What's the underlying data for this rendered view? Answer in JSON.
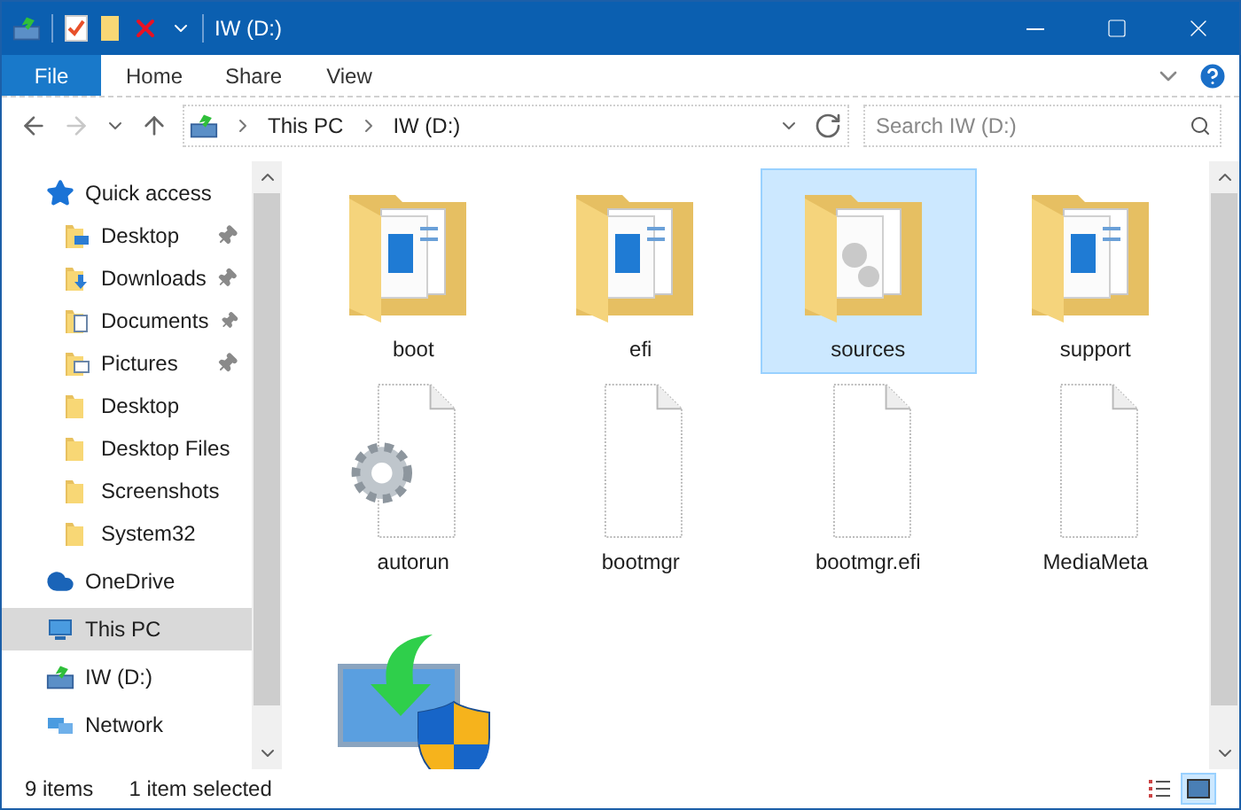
{
  "window": {
    "title": "IW (D:)"
  },
  "ribbon": {
    "tabs": [
      {
        "label": "File",
        "kind": "file",
        "selected": false
      },
      {
        "label": "Home",
        "kind": "tab",
        "selected": false
      },
      {
        "label": "Share",
        "kind": "tab",
        "selected": false
      },
      {
        "label": "View",
        "kind": "tab",
        "selected": false
      }
    ]
  },
  "address": {
    "back_disabled": false,
    "forward_disabled": true,
    "breadcrumb": [
      "This PC",
      "IW (D:)"
    ],
    "search": {
      "placeholder": "Search IW (D:)"
    }
  },
  "sidebar": {
    "items": [
      {
        "label": "Quick access",
        "kind": "star",
        "selected": false,
        "children": [
          {
            "label": "Desktop",
            "kind": "desktop",
            "pinned": true,
            "selected": false
          },
          {
            "label": "Downloads",
            "kind": "downloads",
            "pinned": true,
            "selected": false
          },
          {
            "label": "Documents",
            "kind": "documents",
            "pinned": true,
            "selected": false
          },
          {
            "label": "Pictures",
            "kind": "pictures",
            "pinned": true,
            "selected": false
          },
          {
            "label": "Desktop",
            "kind": "folder",
            "pinned": false,
            "selected": false
          },
          {
            "label": "Desktop Files",
            "kind": "folder",
            "pinned": false,
            "selected": false
          },
          {
            "label": "Screenshots",
            "kind": "folder",
            "pinned": false,
            "selected": false
          },
          {
            "label": "System32",
            "kind": "folder",
            "pinned": false,
            "selected": false
          }
        ]
      },
      {
        "label": "OneDrive",
        "kind": "cloud",
        "selected": false
      },
      {
        "label": "This PC",
        "kind": "pc",
        "selected": true
      },
      {
        "label": "IW (D:)",
        "kind": "drive",
        "selected": false
      },
      {
        "label": "Network",
        "kind": "network",
        "selected": false
      }
    ]
  },
  "files": [
    {
      "name": "boot",
      "kind": "folder",
      "selected": false
    },
    {
      "name": "efi",
      "kind": "folder",
      "selected": false
    },
    {
      "name": "sources",
      "kind": "folder-gears",
      "selected": true
    },
    {
      "name": "support",
      "kind": "folder",
      "selected": false
    },
    {
      "name": "autorun",
      "kind": "file-gear",
      "selected": false
    },
    {
      "name": "bootmgr",
      "kind": "file",
      "selected": false
    },
    {
      "name": "bootmgr.efi",
      "kind": "file",
      "selected": false
    },
    {
      "name": "MediaMeta",
      "kind": "file",
      "selected": false
    },
    {
      "kind": "setup",
      "selected": false
    }
  ],
  "status_bar": {
    "count": "9 items",
    "selection": "1 item selected",
    "views": [
      {
        "kind": "details",
        "selected": false
      },
      {
        "kind": "large-icons",
        "selected": true
      }
    ]
  }
}
